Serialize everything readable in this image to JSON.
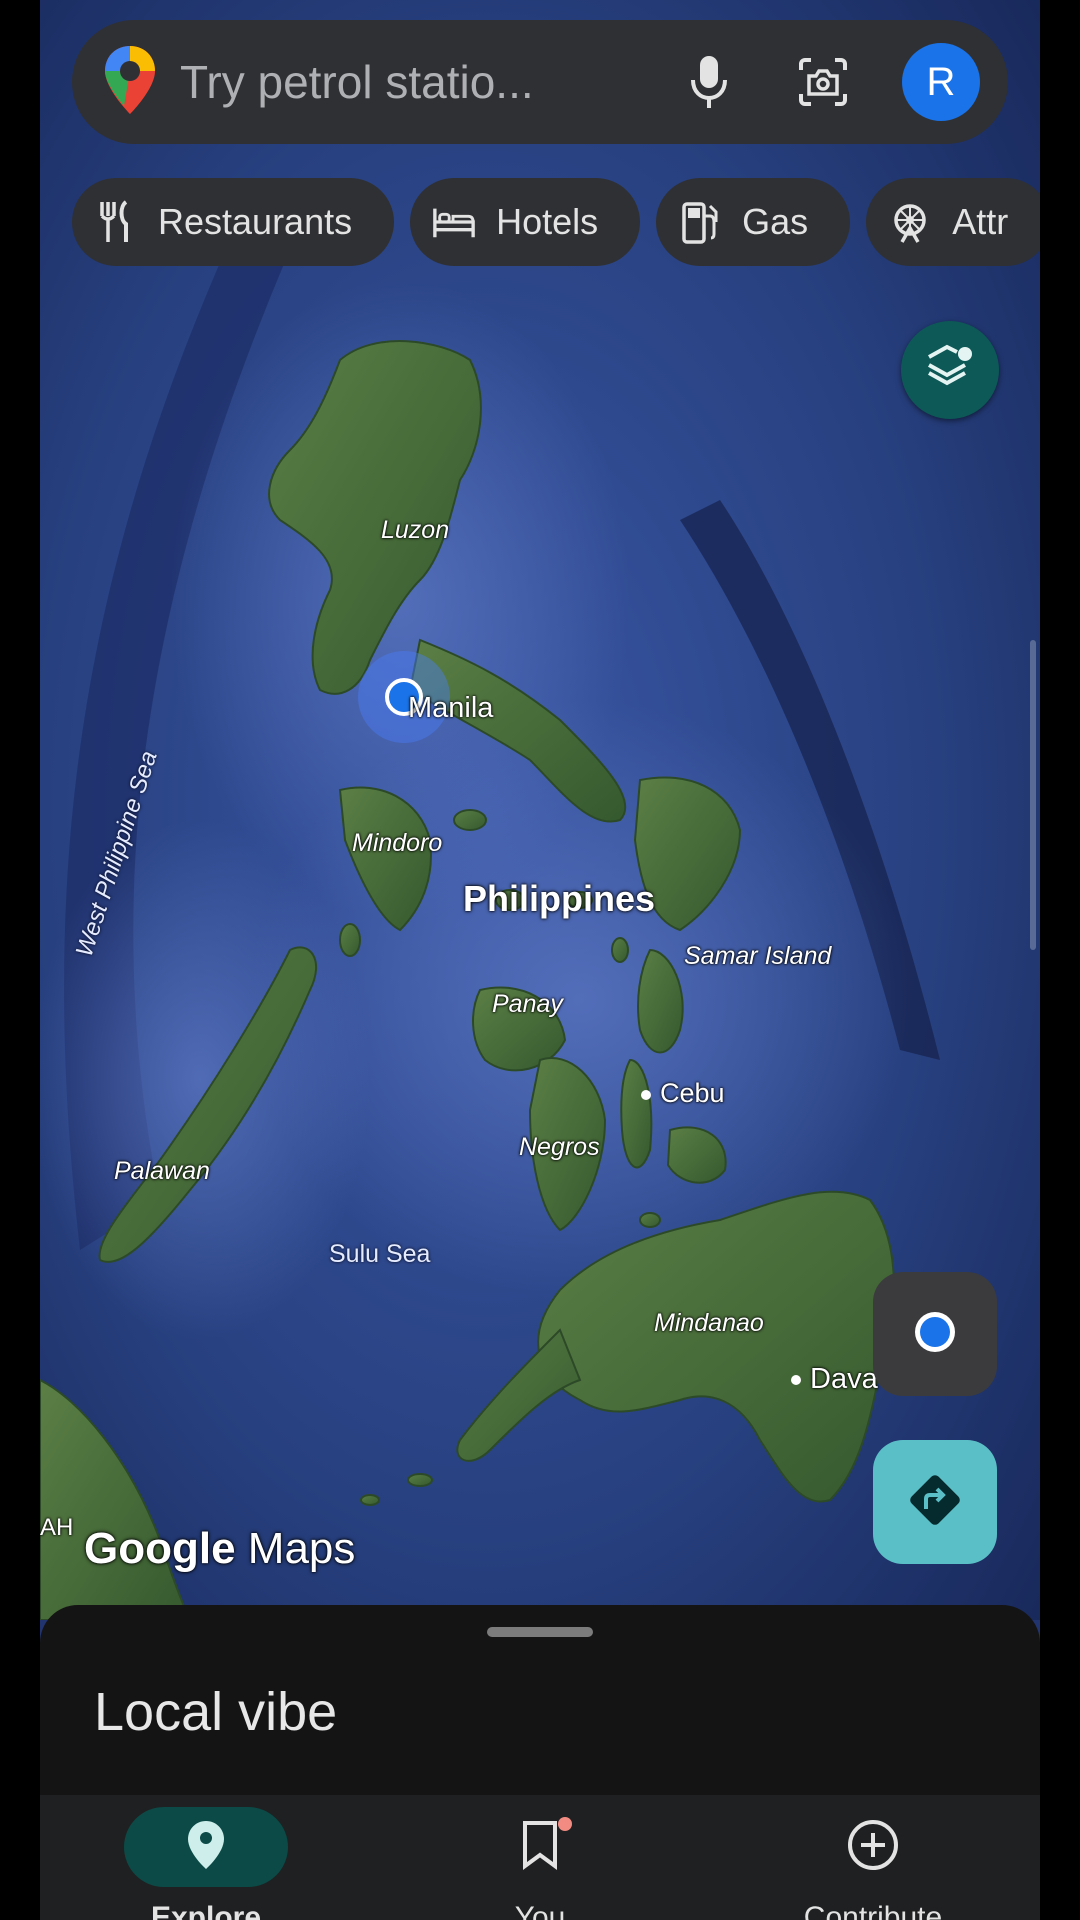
{
  "search": {
    "placeholder": "Try petrol statio...",
    "avatar_initial": "R"
  },
  "chips": [
    {
      "label": "Restaurants",
      "icon": "restaurant-icon"
    },
    {
      "label": "Hotels",
      "icon": "hotel-icon"
    },
    {
      "label": "Gas",
      "icon": "gas-station-icon"
    },
    {
      "label": "Attr",
      "icon": "attractions-icon"
    }
  ],
  "map": {
    "labels": {
      "luzon": "Luzon",
      "manila": "Manila",
      "mindoro": "Mindoro",
      "philippines": "Philippines",
      "samar": "Samar Island",
      "panay": "Panay",
      "cebu": "Cebu",
      "negros": "Negros",
      "palawan": "Palawan",
      "sulu_sea": "Sulu Sea",
      "mindanao": "Mindanao",
      "davao": "Dava",
      "west_ph_sea": "West Philippine Sea",
      "edge": "AH"
    },
    "watermark_google": "Google",
    "watermark_maps": "Maps"
  },
  "sheet": {
    "title": "Local vibe"
  },
  "nav": [
    {
      "label": "Explore",
      "icon": "explore-pin-icon",
      "active": true
    },
    {
      "label": "You",
      "icon": "bookmark-icon",
      "active": false
    },
    {
      "label": "Contribute",
      "icon": "add-circle-icon",
      "active": false
    }
  ],
  "colors": {
    "ocean": "#22346f",
    "land": "#3f6a36",
    "accent_teal": "#0b4a47",
    "directions": "#5bbfc7",
    "location_dot": "#1a73e8"
  }
}
